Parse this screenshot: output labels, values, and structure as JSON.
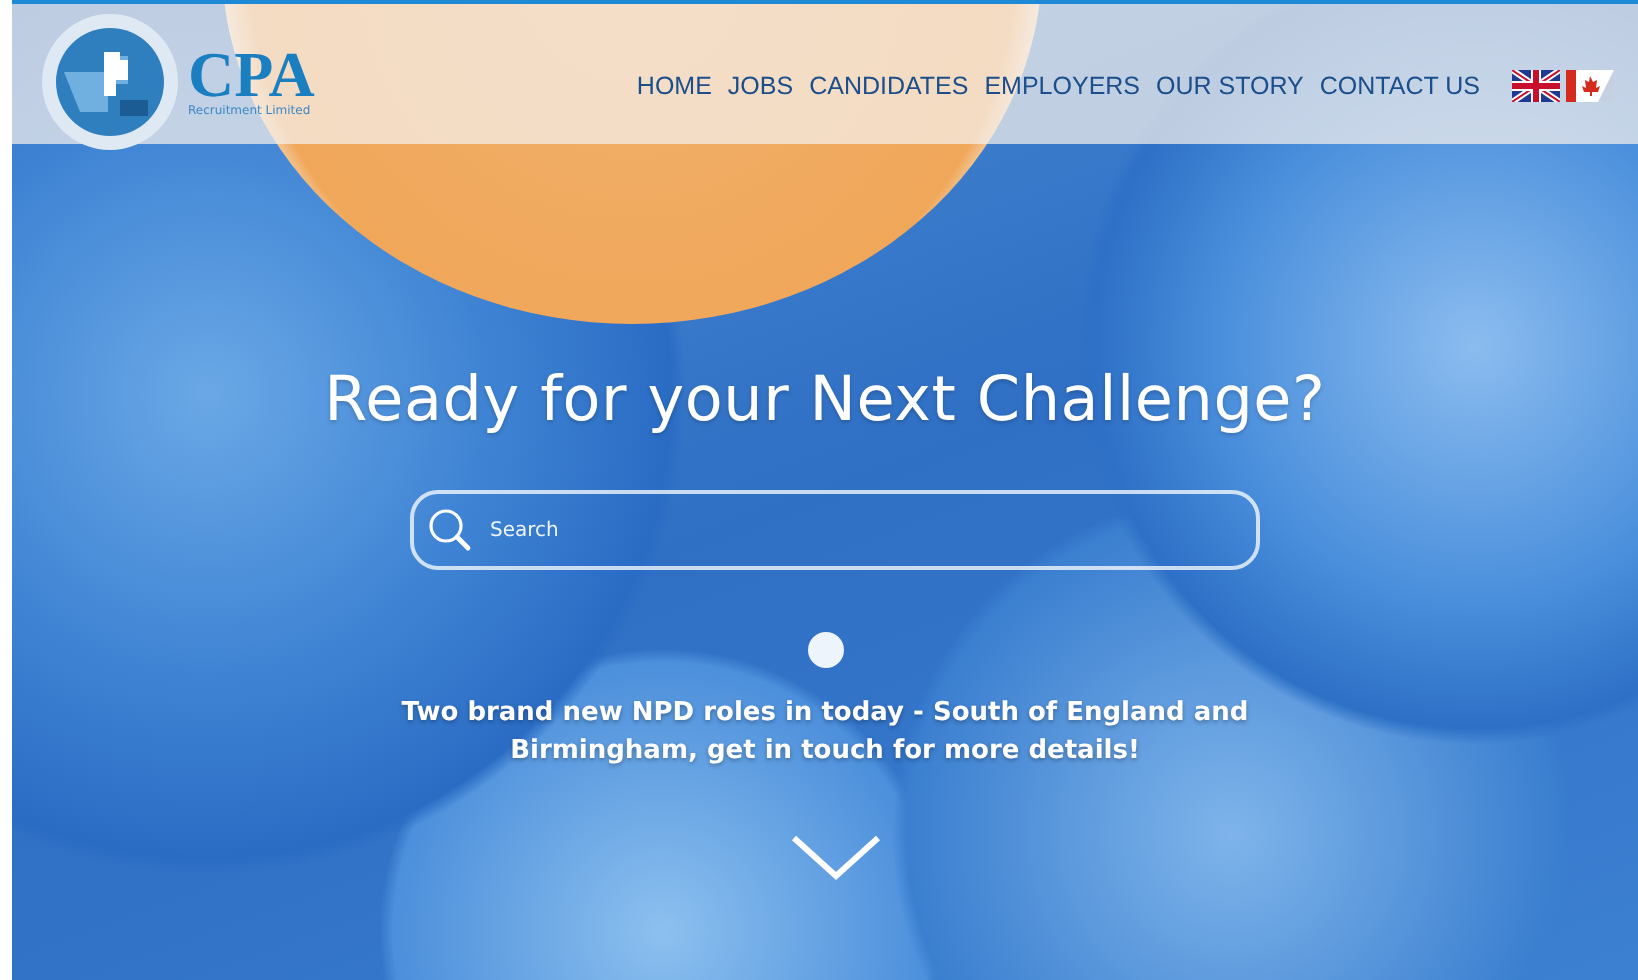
{
  "logo": {
    "name": "CPA",
    "tagline": "Recruitment Limited"
  },
  "nav": [
    "HOME",
    "JOBS",
    "CANDIDATES",
    "EMPLOYERS",
    "OUR STORY",
    "CONTACT US"
  ],
  "hero": {
    "heading": "Ready for your Next Challenge?",
    "search": {
      "placeholder": "Search"
    },
    "announcement": "Two brand new NPD roles in today - South of England and Birmingham, get in touch for more details!"
  }
}
